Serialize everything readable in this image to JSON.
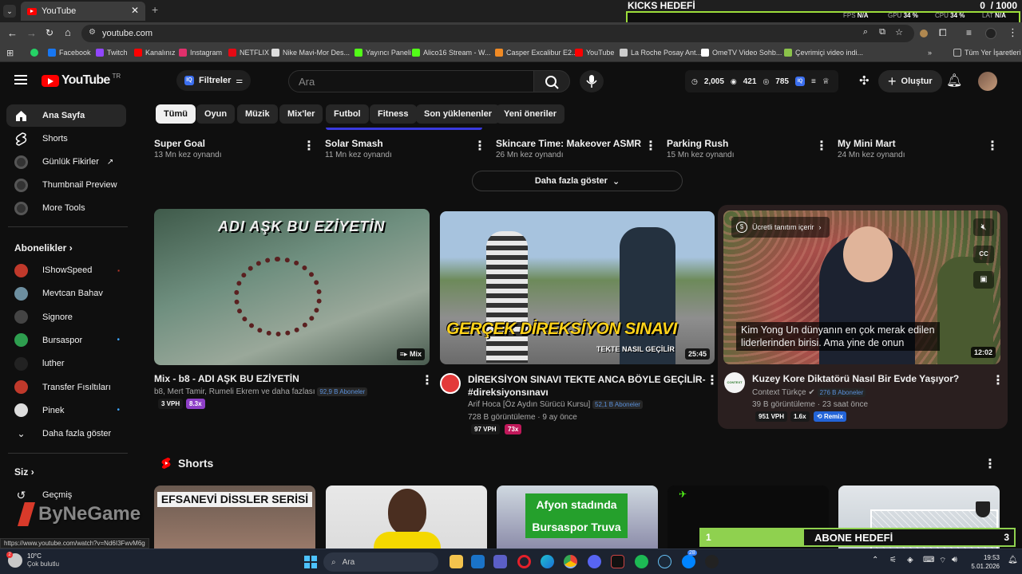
{
  "browser": {
    "tab_title": "YouTube",
    "url": "youtube.com",
    "status_url": "https://www.youtube.com/watch?v=Nd6I3FwvM6g",
    "bookmarks": [
      {
        "label": "Facebook",
        "color": "#1877f2"
      },
      {
        "label": "Twitch",
        "color": "#9146ff"
      },
      {
        "label": "Kanalınız",
        "color": "#ff0000"
      },
      {
        "label": "Instagram",
        "color": "#e1306c"
      },
      {
        "label": "NETFLIX",
        "color": "#e50914"
      },
      {
        "label": "Nike Mavi-Mor Des...",
        "color": "#dddddd"
      },
      {
        "label": "Yayıncı Paneli",
        "color": "#53fc18"
      },
      {
        "label": "Alico16 Stream - W...",
        "color": "#53fc18"
      },
      {
        "label": "Casper Excalibur E2...",
        "color": "#f08a24"
      },
      {
        "label": "YouTube",
        "color": "#ff0000"
      },
      {
        "label": "La Roche Posay Ant...",
        "color": "#cccccc"
      },
      {
        "label": "OmeTV Video Sohb...",
        "color": "#ffffff"
      },
      {
        "label": "Çevrimiçi video indi...",
        "color": "#8bc34a"
      }
    ],
    "all_bookmarks": "Tüm Yer İşaretleri"
  },
  "kicks_overlay": {
    "title": "KICKS HEDEFİ",
    "current": "0",
    "target": "/ 1000",
    "fps_label": "FPS",
    "fps": "N/A",
    "gpu_label": "GPU",
    "gpu": "34 %",
    "cpu_label": "CPU",
    "cpu": "34 %",
    "lat_label": "LAT",
    "lat": "N/A"
  },
  "header": {
    "logo": "YouTube",
    "region": "TR",
    "filters": "Filtreler",
    "search_placeholder": "Ara",
    "stat1": "2,005",
    "stat2": "421",
    "stat3": "785",
    "create": "Oluştur"
  },
  "chips": [
    "Tümü",
    "Oyun",
    "Müzik",
    "Mix'ler",
    "Futbol",
    "Fitness",
    "Son yüklenenler",
    "Yeni öneriler"
  ],
  "sidebar": {
    "top": [
      {
        "label": "Ana Sayfa"
      },
      {
        "label": "Shorts"
      },
      {
        "label": "Günlük Fikirler"
      },
      {
        "label": "Thumbnail Preview"
      },
      {
        "label": "More Tools"
      }
    ],
    "subs_header": "Abonelikler",
    "subs": [
      {
        "label": "IShowSpeed",
        "color": "#c0392b"
      },
      {
        "label": "Mevtcan Bahav",
        "color": "#6d8fa0"
      },
      {
        "label": "Signore",
        "color": "#444444"
      },
      {
        "label": "Bursaspor",
        "color": "#2e9e4f"
      },
      {
        "label": "luther",
        "color": "#222222"
      },
      {
        "label": "Transfer Fısıltıları",
        "color": "#c0392b"
      },
      {
        "label": "Pinek",
        "color": "#dddddd"
      }
    ],
    "show_more": "Daha fazla göster",
    "you_header": "Siz",
    "history": "Geçmiş"
  },
  "games_row": [
    {
      "title": "Super Goal",
      "meta": "13 Mn kez oynandı"
    },
    {
      "title": "Solar Smash",
      "meta": "11 Mn kez oynandı"
    },
    {
      "title": "Skincare Time: Makeover ASMR",
      "meta": "26 Mn kez oynandı"
    },
    {
      "title": "Parking Rush",
      "meta": "15 Mn kez oynandı"
    },
    {
      "title": "My Mini Mart",
      "meta": "24 Mn kez oynandı"
    }
  ],
  "show_more_games": "Daha fazla göster",
  "videos": [
    {
      "thumb_text": "ADI AŞK BU EZİYETİN",
      "corner": "Mix",
      "title": "Mix - b8 - ADI AŞK BU EZİYETİN",
      "channel": "b8, Mert Tamir, Rumeli Ekrem ve daha fazlası",
      "subs": "92,9 B Aboneler",
      "vph": "3 VPH",
      "multi": "8.3x"
    },
    {
      "thumb_text": "GERÇEK DİREKSİYON SINAVI",
      "thumb_sub": "TEKTE NASIL GEÇİLİR",
      "duration": "25:45",
      "title_line1": "DİREKSİYON SINAVI TEKTE ANCA BÖYLE GEÇİLİR-",
      "title_line2": "#direksiyonsınavı",
      "channel": "Arif Hoca [Öz Aydın Sürücü Kursu]",
      "subs": "52,1 B Aboneler",
      "meta": "728 B görüntüleme · 9 ay önce",
      "vph": "97 VPH",
      "multi": "73x"
    },
    {
      "promo": "Ücretli tanıtım içerir",
      "caption1": "Kim Yong Un dünyanın en çok merak edilen",
      "caption2": "liderlerinden birisi. Ama yine de onun",
      "duration": "12:02",
      "title": "Kuzey Kore Diktatörü Nasıl Bir Evde Yaşıyor?",
      "channel": "Context Türkçe",
      "subs": "276 B Aboneler",
      "meta": "39 B görüntüleme · 23 saat önce",
      "vph": "951 VPH",
      "multi": "1.6x",
      "remix": "Remix",
      "avatar_text": "CONTEXT"
    }
  ],
  "shorts": {
    "header": "Shorts",
    "items": [
      {
        "text": "EFSANEVİ DİSSLER SERİSİ"
      },
      {
        "text": ""
      },
      {
        "text": "Afyon stadında Bursaspor Truva"
      },
      {
        "text": ""
      },
      {
        "text": ""
      }
    ]
  },
  "watermark": "ByNeGame",
  "abone_overlay": {
    "current": "1",
    "title": "ABONE HEDEFİ",
    "target": "3",
    "progress": 0.33
  },
  "taskbar": {
    "temp": "10°C",
    "weather": "Çok bulutlu",
    "search": "Ara",
    "time": "19:53",
    "date": "5.01.2026",
    "badge_count": "28"
  }
}
